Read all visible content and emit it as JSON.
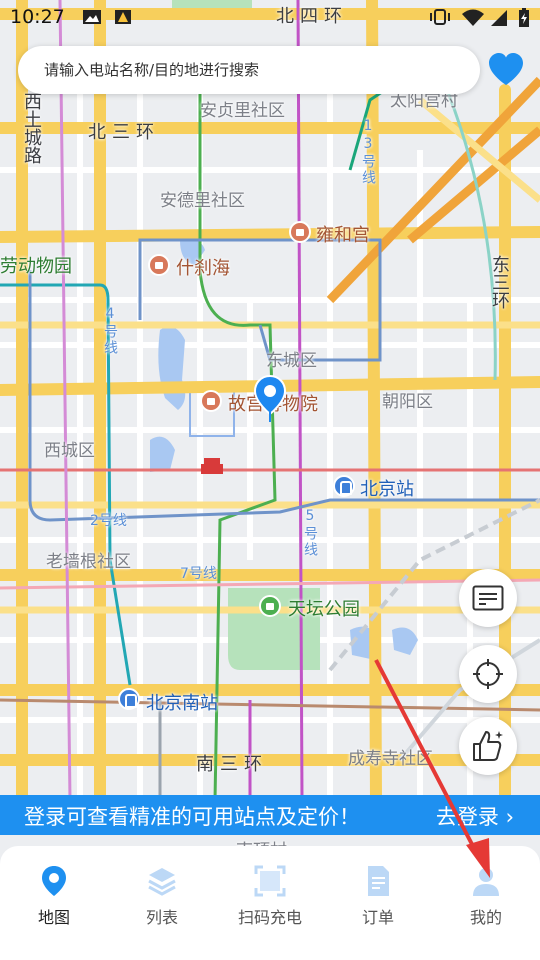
{
  "status_bar": {
    "time": "10:27"
  },
  "search": {
    "placeholder": "请输入电站名称/目的地进行搜索"
  },
  "map": {
    "areas": [
      "安贞里社区",
      "安德里社区",
      "东城区",
      "朝阳区",
      "西城区",
      "老墙根社区",
      "成寿寺社区",
      "太阳宫村",
      "南顶村"
    ],
    "roads": [
      "北四环",
      "北三环",
      "南三环",
      "西土城路",
      "东三环"
    ],
    "pois": [
      "雍和宫",
      "什刹海",
      "故宫博物院",
      "天坛公园",
      "劳动物园"
    ],
    "stations": [
      "北京站",
      "北京南站"
    ],
    "lines": [
      "13号线",
      "4号线",
      "2号线",
      "5号线",
      "7号线"
    ]
  },
  "banner": {
    "message": "登录可查看精准的可用站点及定价！",
    "login": "去登录"
  },
  "nav": {
    "items": [
      {
        "label": "地图",
        "icon": "map-pin-icon",
        "active": true
      },
      {
        "label": "列表",
        "icon": "layers-icon",
        "active": false
      },
      {
        "label": "扫码充电",
        "icon": "scan-icon",
        "active": false
      },
      {
        "label": "订单",
        "icon": "document-icon",
        "active": false
      },
      {
        "label": "我的",
        "icon": "user-icon",
        "active": false
      }
    ]
  },
  "colors": {
    "accent": "#1e90f0",
    "banner": "#1e90f0",
    "heart": "#1e90f0",
    "arrow": "#e53935"
  }
}
